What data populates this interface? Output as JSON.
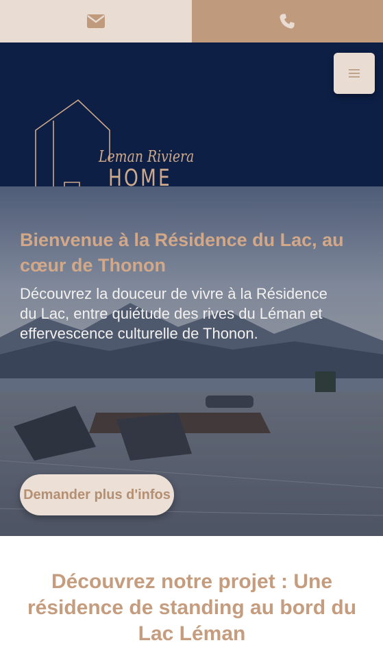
{
  "topbar": {
    "mail_icon": "envelope-icon",
    "phone_icon": "phone-icon",
    "colors": {
      "mail_bg": "#e9dcd2",
      "phone_bg": "#c09a7d"
    }
  },
  "header": {
    "background": "#0d1f45",
    "logo": {
      "script": "Leman Riviera",
      "word": "HOME"
    },
    "menu_icon": "hamburger-icon"
  },
  "hero": {
    "title": "Bienvenue à la Résidence du Lac, au cœur de Thonon",
    "text": "Découvrez la douceur de vivre à la Résidence du Lac, entre quiétude des rives du Léman et effervescence culturelle de Thonon.",
    "cta_label": "Demander plus d'infos"
  },
  "section": {
    "title": "Découvrez notre projet : Une résidence de standing au bord du Lac Léman"
  },
  "colors": {
    "accent": "#c59c7e",
    "navy": "#0d1f45"
  }
}
